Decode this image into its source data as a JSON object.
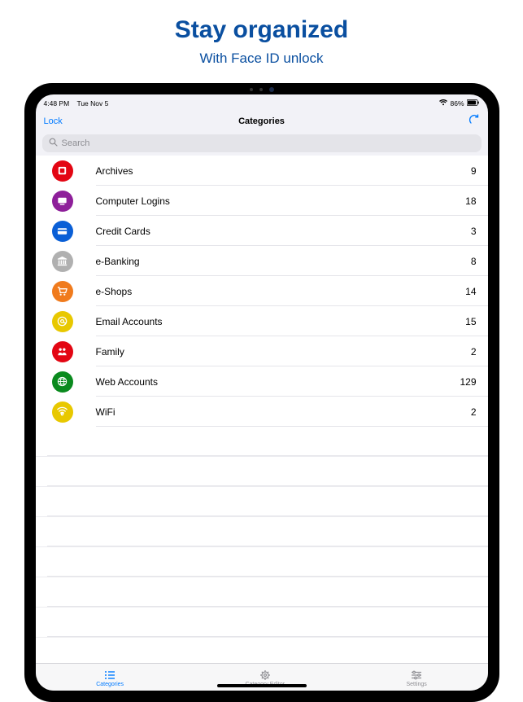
{
  "marketing": {
    "headline": "Stay organized",
    "subhead": "With Face ID unlock"
  },
  "statusbar": {
    "time": "4:48 PM",
    "date": "Tue Nov 5",
    "battery": "86%"
  },
  "navbar": {
    "left": "Lock",
    "title": "Categories"
  },
  "search": {
    "placeholder": "Search"
  },
  "categories": [
    {
      "icon": "archive-icon",
      "color": "#e30613",
      "label": "Archives",
      "count": "9"
    },
    {
      "icon": "computer-icon",
      "color": "#8e1f9a",
      "label": "Computer Logins",
      "count": "18"
    },
    {
      "icon": "card-icon",
      "color": "#0a5fd6",
      "label": "Credit Cards",
      "count": "3"
    },
    {
      "icon": "bank-icon",
      "color": "#b0b0b0",
      "label": "e-Banking",
      "count": "8"
    },
    {
      "icon": "cart-icon",
      "color": "#f07b1d",
      "label": "e-Shops",
      "count": "14"
    },
    {
      "icon": "email-icon",
      "color": "#e8c800",
      "label": "Email Accounts",
      "count": "15"
    },
    {
      "icon": "family-icon",
      "color": "#e30613",
      "label": "Family",
      "count": "2"
    },
    {
      "icon": "globe-icon",
      "color": "#0a8a1e",
      "label": "Web Accounts",
      "count": "129"
    },
    {
      "icon": "wifi-icon",
      "color": "#e8c800",
      "label": "WiFi",
      "count": "2"
    }
  ],
  "tabs": [
    {
      "icon": "list-icon",
      "label": "Categories",
      "active": true
    },
    {
      "icon": "gear-icon",
      "label": "Category Editor",
      "active": false
    },
    {
      "icon": "sliders-icon",
      "label": "Settings",
      "active": false
    }
  ]
}
